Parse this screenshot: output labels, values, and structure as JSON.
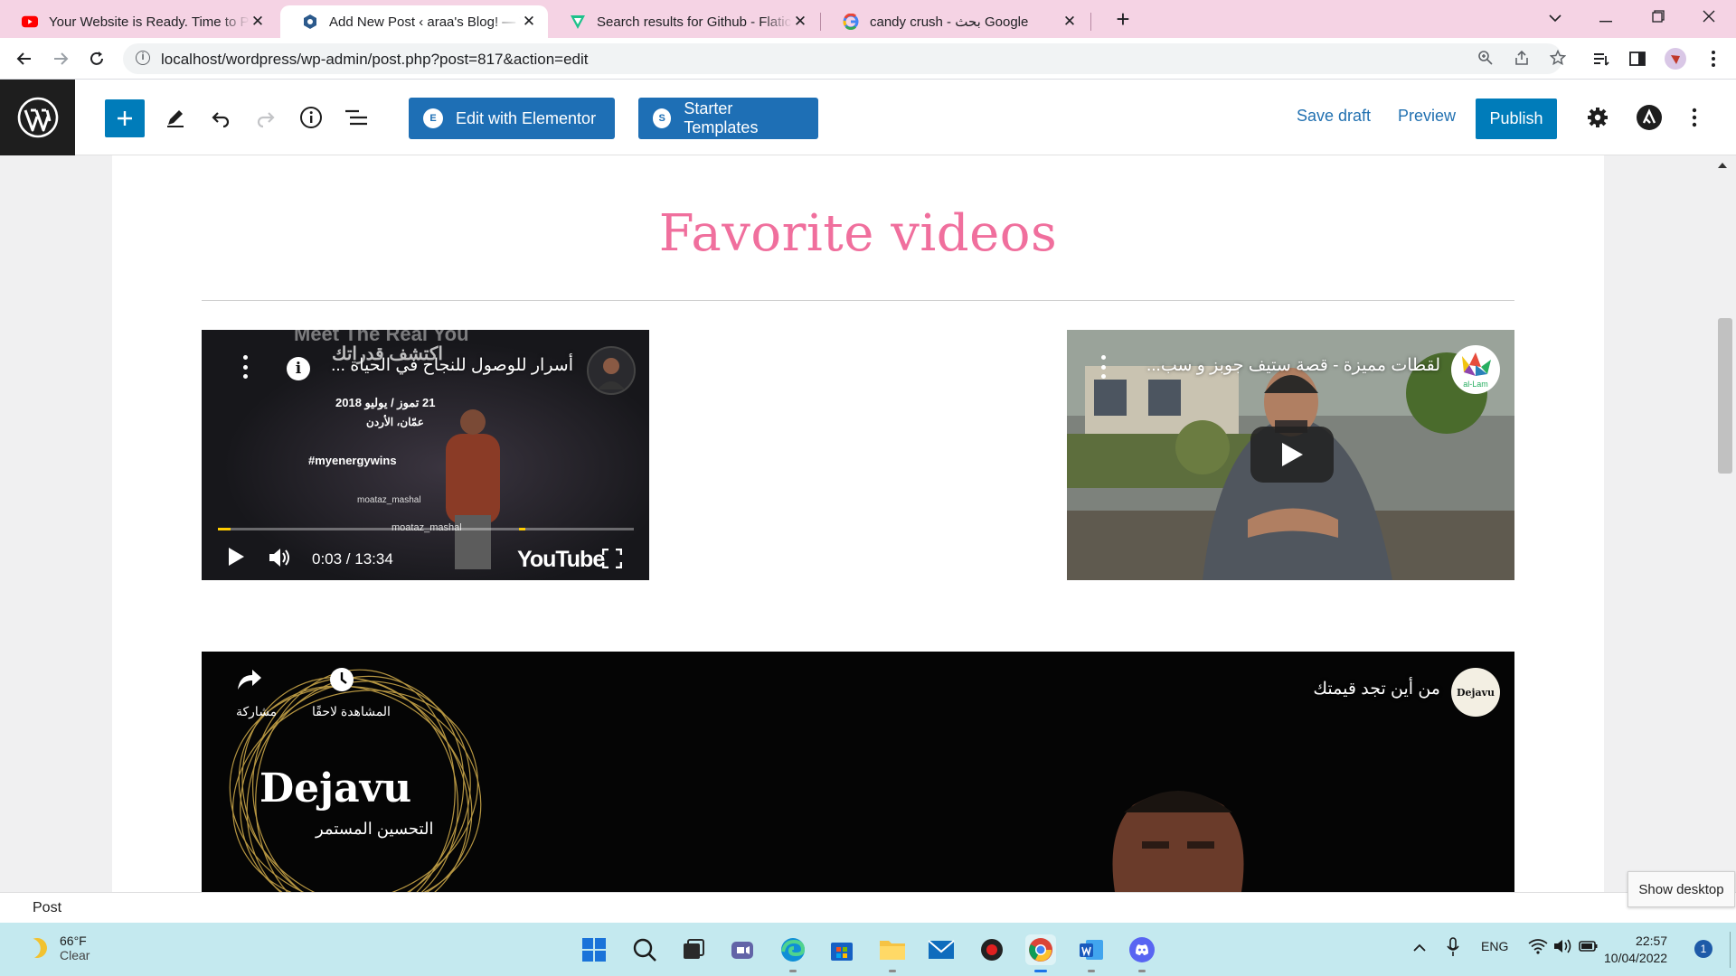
{
  "browser": {
    "tabs": [
      {
        "title": "Your Website is Ready. Time to Publish",
        "favicon": "youtube-icon",
        "active": false
      },
      {
        "title": "Add New Post ‹ araa's Blog! — WordPress",
        "favicon": "wordpress-site-icon",
        "active": true
      },
      {
        "title": "Search results for Github - Flaticon",
        "favicon": "flaticon-icon",
        "active": false
      },
      {
        "title": "candy crush - بحث Google",
        "favicon": "google-icon",
        "active": false
      }
    ],
    "tab_close": "✕",
    "new_tab": "+",
    "url": "localhost/wordpress/wp-admin/post.php?post=817&action=edit"
  },
  "editor": {
    "buttons": {
      "elementor": "Edit with Elementor",
      "elementor_badge": "E",
      "starter": "Starter Templates",
      "starter_badge": "S",
      "save_draft": "Save draft",
      "preview": "Preview",
      "publish": "Publish"
    }
  },
  "content": {
    "heading": "Favorite videos",
    "videos": [
      {
        "title": "أسرار للوصول للنجاح في الحياة ...",
        "time": "0:03 / 13:34",
        "brand": "YouTube",
        "overlay_lines": [
          "Meet The Real You",
          "اكتشف قدراتك",
          "21 تموز / يوليو 2018",
          "عمّان، الأردن",
          "#myenergywins",
          "moataz_mashal",
          "moataz_mashal"
        ]
      },
      {
        "title": "لقطات مميزة - قصة ستيف جوبز و سب...",
        "channel_label": "al-Lam"
      },
      {
        "title": "من أين تجد قيمتك",
        "channel_label": "Dejavu",
        "share_label": "مشاركة",
        "watch_later_label": "المشاهدة لاحقًا",
        "logo_title": "Dejavu",
        "logo_subtitle": "التحسين المستمر"
      }
    ]
  },
  "statusbar": {
    "breadcrumb": "Post",
    "tooltip": "Show desktop"
  },
  "taskbar": {
    "temperature": "66°F",
    "condition": "Clear",
    "lang": "ENG",
    "time": "22:57",
    "date": "10/04/2022",
    "notification_count": "1"
  },
  "colors": {
    "wp_blue": "#007cba",
    "heading_pink": "#f06f9d",
    "tab_strip": "#f5d3e4",
    "taskbar": "#c4e9ef"
  }
}
